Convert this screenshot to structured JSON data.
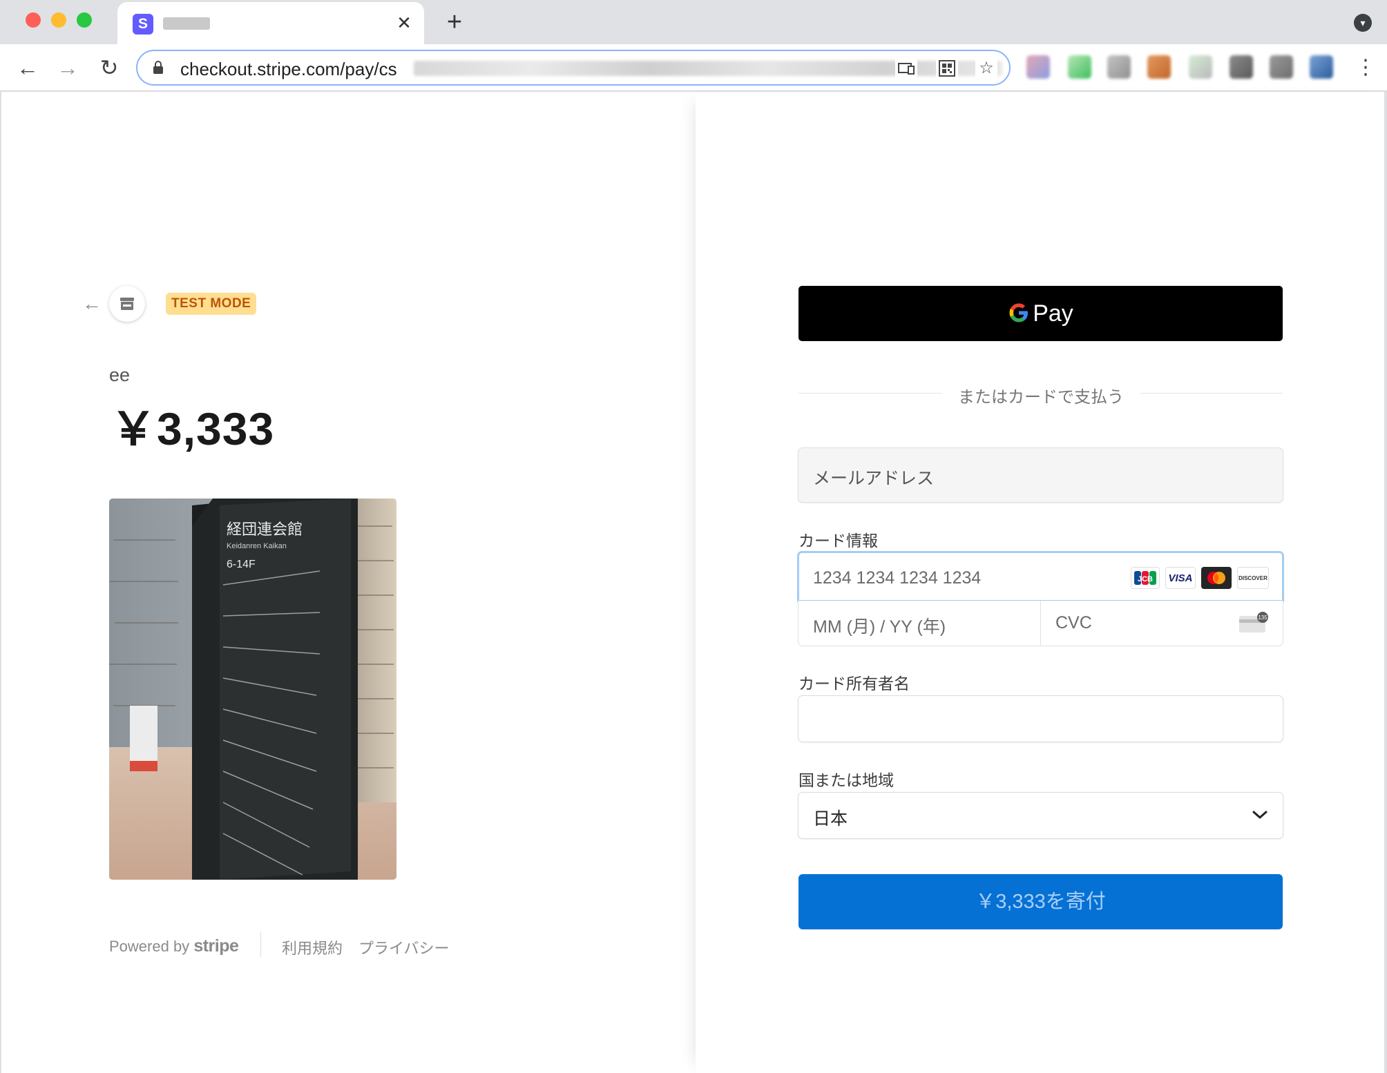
{
  "browser": {
    "tab_close": "✕",
    "new_tab": "+",
    "url": "checkout.stripe.com/pay/cs",
    "menu_icon": "⋮"
  },
  "summary": {
    "mode_badge": "TEST MODE",
    "product_name": "ee",
    "price": "￥3,333"
  },
  "footer": {
    "powered_by": "Powered by",
    "brand": "stripe",
    "terms": "利用規約",
    "privacy": "プライバシー"
  },
  "payment": {
    "gpay_label": "Pay",
    "divider_text": "またはカードで支払う",
    "email_placeholder": "メールアドレス",
    "card_label": "カード情報",
    "card_number_placeholder": "1234 1234 1234 1234",
    "expiry_placeholder": "MM (月) / YY (年)",
    "cvc_placeholder": "CVC",
    "card_brands": [
      "JCB",
      "VISA",
      "Mastercard",
      "DISCOVER"
    ],
    "name_label": "カード所有者名",
    "name_value": "",
    "country_label": "国または地域",
    "country_value": "日本",
    "submit_label": "￥3,333を寄付"
  },
  "colors": {
    "pay_button": "#0571d5",
    "gpay_button": "#000000",
    "test_badge_bg": "#ffde92",
    "test_badge_text": "#bb5504",
    "focus_ring": "#a2cdf4"
  }
}
